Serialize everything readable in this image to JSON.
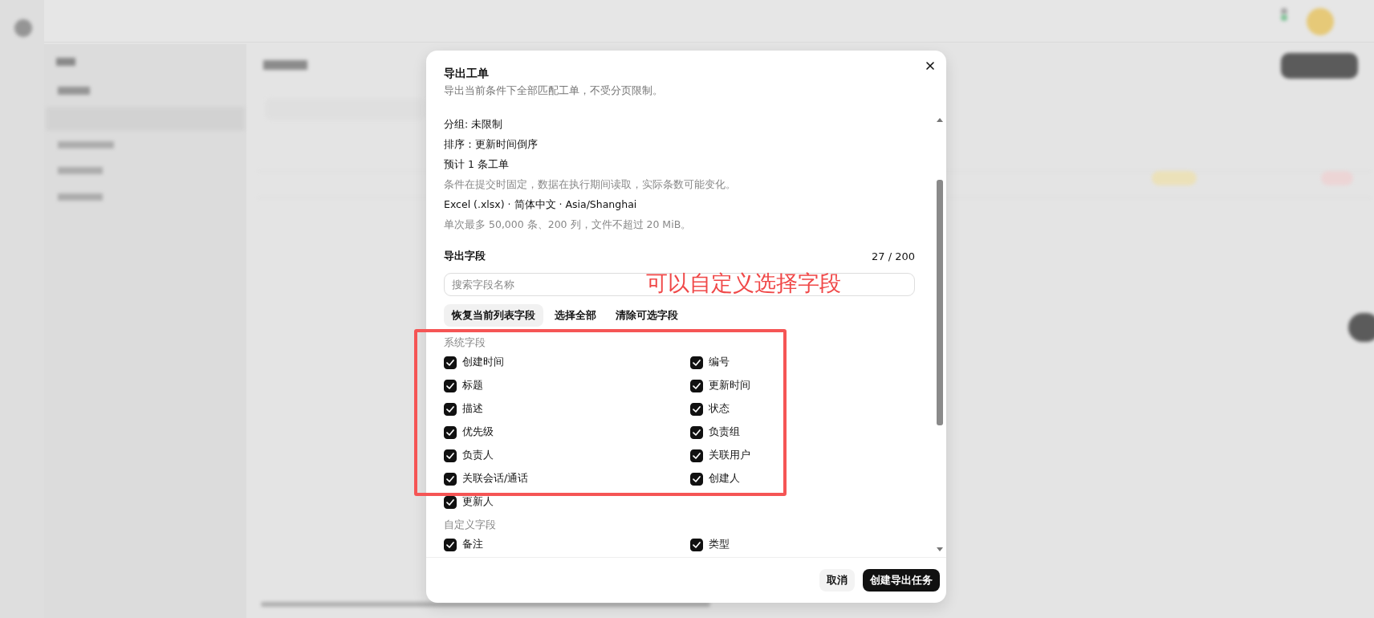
{
  "dialog": {
    "title": "导出工单",
    "subtitle": "导出当前条件下全部匹配工单，不受分页限制。",
    "summary": [
      {
        "text": "分组: 未限制",
        "kind": "primary"
      },
      {
        "text": "排序：更新时间倒序",
        "kind": "primary"
      },
      {
        "text": "预计 1 条工单",
        "kind": "primary"
      },
      {
        "text": "条件在提交时固定，数据在执行期间读取，实际条数可能变化。",
        "kind": "muted"
      },
      {
        "text": "Excel (.xlsx) · 简体中文 · Asia/Shanghai",
        "kind": "primary"
      },
      {
        "text": "单次最多 50,000 条、200 列，文件不超过 20 MiB。",
        "kind": "muted"
      }
    ],
    "fields_header": {
      "label": "导出字段",
      "count": "27 / 200"
    },
    "search": {
      "placeholder": "搜索字段名称"
    },
    "actions": [
      {
        "label": "恢复当前列表字段",
        "highlighted": true
      },
      {
        "label": "选择全部",
        "highlighted": false
      },
      {
        "label": "清除可选字段",
        "highlighted": false
      }
    ],
    "groups": [
      {
        "title": "系统字段",
        "fields": [
          {
            "label": "创建时间",
            "checked": true
          },
          {
            "label": "编号",
            "checked": true
          },
          {
            "label": "标题",
            "checked": true
          },
          {
            "label": "更新时间",
            "checked": true
          },
          {
            "label": "描述",
            "checked": true
          },
          {
            "label": "状态",
            "checked": true
          },
          {
            "label": "优先级",
            "checked": true
          },
          {
            "label": "负责组",
            "checked": true
          },
          {
            "label": "负责人",
            "checked": true
          },
          {
            "label": "关联用户",
            "checked": true
          },
          {
            "label": "关联会话/通话",
            "checked": true
          },
          {
            "label": "创建人",
            "checked": true
          },
          {
            "label": "更新人",
            "checked": true
          }
        ]
      },
      {
        "title": "自定义字段",
        "fields": [
          {
            "label": "备注",
            "checked": true
          },
          {
            "label": "类型",
            "checked": true
          }
        ]
      }
    ],
    "buttons": [
      {
        "label": "取消",
        "kind": "secondary"
      },
      {
        "label": "创建导出任务",
        "kind": "primary"
      }
    ]
  },
  "annotation": {
    "text": "可以自定义选择字段"
  }
}
